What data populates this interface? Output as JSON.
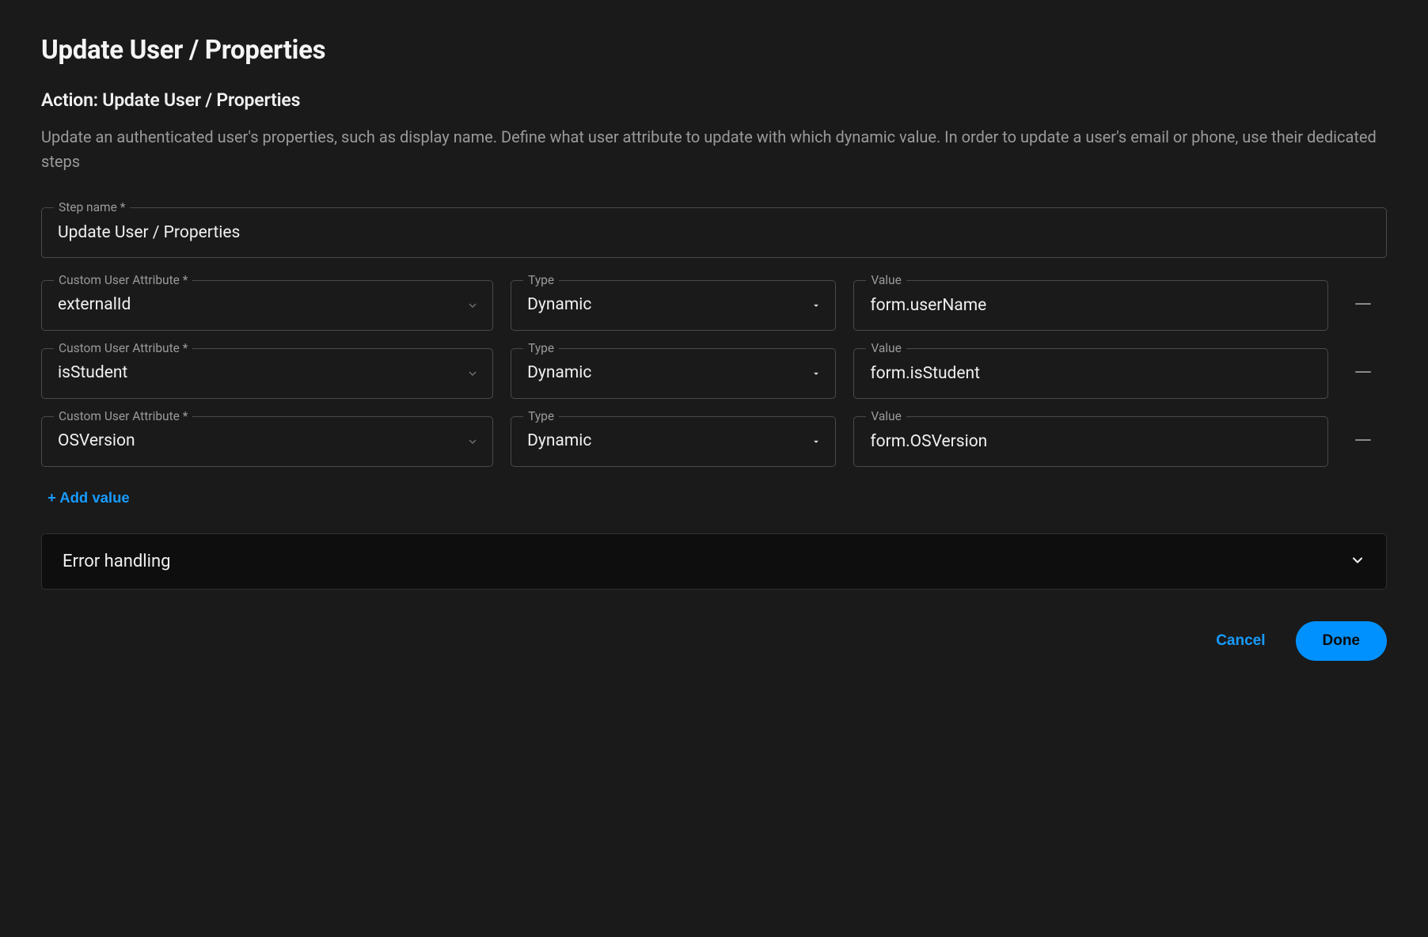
{
  "header": {
    "title": "Update User / Properties",
    "subtitle": "Action: Update User / Properties",
    "description": "Update an authenticated user's properties, such as display name. Define what user attribute to update with which dynamic value. In order to update a user's email or phone, use their dedicated steps"
  },
  "stepName": {
    "label": "Step name *",
    "value": "Update User / Properties"
  },
  "labels": {
    "attribute": "Custom User Attribute *",
    "type": "Type",
    "value": "Value"
  },
  "rows": [
    {
      "attribute": "externalId",
      "type": "Dynamic",
      "value": "form.userName"
    },
    {
      "attribute": "isStudent",
      "type": "Dynamic",
      "value": "form.isStudent"
    },
    {
      "attribute": "OSVersion",
      "type": "Dynamic",
      "value": "form.OSVersion"
    }
  ],
  "addValueLabel": "+ Add value",
  "accordion": {
    "label": "Error handling"
  },
  "footer": {
    "cancel": "Cancel",
    "done": "Done"
  }
}
